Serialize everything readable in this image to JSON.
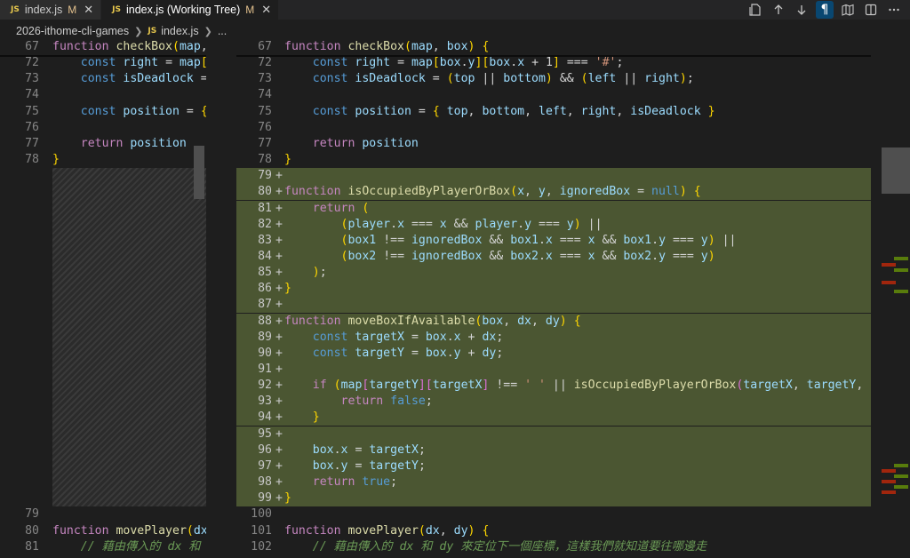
{
  "tabs": [
    {
      "icon": "JS",
      "label": "index.js",
      "status": "M",
      "close": "✕"
    },
    {
      "icon": "JS",
      "label": "index.js (Working Tree)",
      "status": "M",
      "close": "✕"
    }
  ],
  "actions": [
    "open-file-icon",
    "arrow-up-icon",
    "arrow-down-icon",
    "pilcrow-icon",
    "map-icon",
    "split-icon",
    "more-icon"
  ],
  "breadcrumb": {
    "folder": "2026-ithome-cli-games",
    "icon": "JS",
    "file": "index.js",
    "more": "..."
  },
  "left": {
    "lines": [
      {
        "n": "67",
        "t": "function checkBox(map, ox"
      },
      {
        "n": "72",
        "t": "    const right = map[bo"
      },
      {
        "n": "73",
        "t": "    const isDeadlock = ("
      },
      {
        "n": "74",
        "t": ""
      },
      {
        "n": "75",
        "t": "    const position = { t"
      },
      {
        "n": "76",
        "t": ""
      },
      {
        "n": "77",
        "t": "    return position"
      },
      {
        "n": "78",
        "t": "}"
      },
      {
        "n": "79",
        "t": ""
      },
      {
        "n": "80",
        "t": "function movePlayer(dx,"
      },
      {
        "n": "81",
        "t": "    // 藉由傳入的 dx 和 d"
      }
    ]
  },
  "right": {
    "lines": [
      {
        "n": "67",
        "m": "",
        "t": "function checkBox(map, box) {"
      },
      {
        "n": "72",
        "m": "",
        "t": "    const right = map[box.y][box.x + 1] === '#';"
      },
      {
        "n": "73",
        "m": "",
        "t": "    const isDeadlock = (top || bottom) && (left || right);"
      },
      {
        "n": "74",
        "m": "",
        "t": ""
      },
      {
        "n": "75",
        "m": "",
        "t": "    const position = { top, bottom, left, right, isDeadlock }"
      },
      {
        "n": "76",
        "m": "",
        "t": ""
      },
      {
        "n": "77",
        "m": "",
        "t": "    return position"
      },
      {
        "n": "78",
        "m": "",
        "t": "}"
      },
      {
        "n": "79",
        "m": "+",
        "t": ""
      },
      {
        "n": "80",
        "m": "+",
        "t": "function isOccupiedByPlayerOrBox(x, y, ignoredBox = null) {"
      },
      {
        "n": "81",
        "m": "+",
        "t": "    return ("
      },
      {
        "n": "82",
        "m": "+",
        "t": "        (player.x === x && player.y === y) ||"
      },
      {
        "n": "83",
        "m": "+",
        "t": "        (box1 !== ignoredBox && box1.x === x && box1.y === y) ||"
      },
      {
        "n": "84",
        "m": "+",
        "t": "        (box2 !== ignoredBox && box2.x === x && box2.y === y)"
      },
      {
        "n": "85",
        "m": "+",
        "t": "    );"
      },
      {
        "n": "86",
        "m": "+",
        "t": "}"
      },
      {
        "n": "87",
        "m": "+",
        "t": ""
      },
      {
        "n": "88",
        "m": "+",
        "t": "function moveBoxIfAvailable(box, dx, dy) {"
      },
      {
        "n": "89",
        "m": "+",
        "t": "    const targetX = box.x + dx;"
      },
      {
        "n": "90",
        "m": "+",
        "t": "    const targetY = box.y + dy;"
      },
      {
        "n": "91",
        "m": "+",
        "t": ""
      },
      {
        "n": "92",
        "m": "+",
        "t": "    if (map[targetY][targetX] !== ' ' || isOccupiedByPlayerOrBox(targetX, targetY, box)) {"
      },
      {
        "n": "93",
        "m": "+",
        "t": "        return false;"
      },
      {
        "n": "94",
        "m": "+",
        "t": "    }"
      },
      {
        "n": "95",
        "m": "+",
        "t": ""
      },
      {
        "n": "96",
        "m": "+",
        "t": "    box.x = targetX;"
      },
      {
        "n": "97",
        "m": "+",
        "t": "    box.y = targetY;"
      },
      {
        "n": "98",
        "m": "+",
        "t": "    return true;"
      },
      {
        "n": "99",
        "m": "+",
        "t": "}"
      },
      {
        "n": "100",
        "m": "",
        "t": ""
      },
      {
        "n": "101",
        "m": "",
        "t": "function movePlayer(dx, dy) {"
      },
      {
        "n": "102",
        "m": "",
        "t": "    // 藉由傳入的 dx 和 dy 來定位下一個座標，這樣我們就知道要往哪邊走"
      }
    ]
  },
  "colors": {
    "inserted": "#4b5632",
    "accent": "#094771"
  }
}
